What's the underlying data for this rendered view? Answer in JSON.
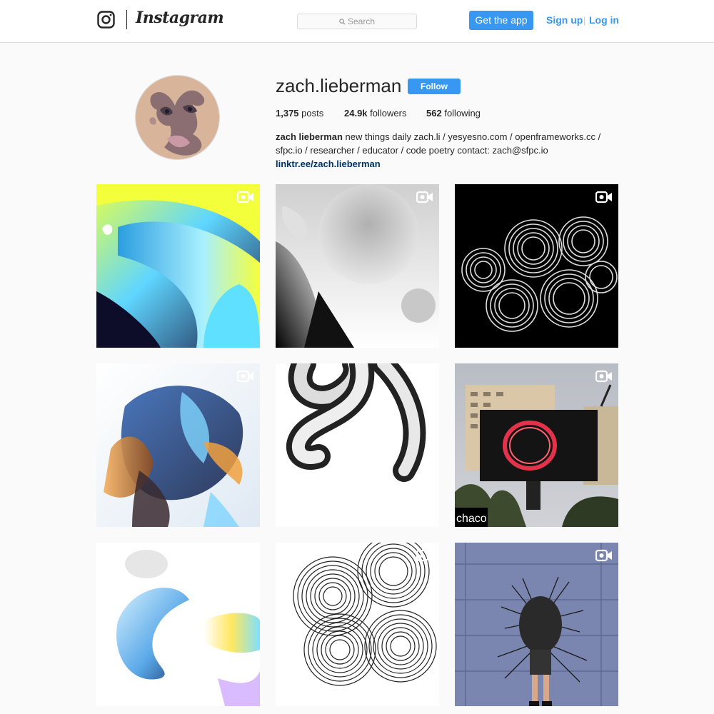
{
  "header": {
    "brand": "Instagram",
    "search_placeholder": "Search",
    "get_app_label": "Get the app",
    "signup_label": "Sign up",
    "separator": "|",
    "login_label": "Log in"
  },
  "profile": {
    "username": "zach.lieberman",
    "follow_label": "Follow",
    "posts_count": "1,375",
    "posts_label": "posts",
    "followers_count": "24.9k",
    "followers_label": "followers",
    "following_count": "562",
    "following_label": "following",
    "full_name": "zach lieberman",
    "bio_text": " new things daily zach.li / yesyesno.com / openframeworks.cc / sfpc.io / researcher / educator / code poetry contact: zach@sfpc.io ",
    "bio_link": "linktr.ee/zach.lieberman"
  },
  "posts": [
    {
      "icon": "video-icon"
    },
    {
      "icon": "video-icon"
    },
    {
      "icon": "video-icon"
    },
    {
      "icon": "video-icon"
    },
    {
      "icon": "video-icon"
    },
    {
      "icon": "video-icon",
      "overlay_text": "chaco"
    },
    {
      "icon": "video-icon"
    },
    {
      "icon": "video-icon"
    },
    {
      "icon": "video-icon"
    }
  ],
  "colors": {
    "accent": "#3897f0",
    "link": "#003569",
    "border": "#dbdbdb"
  }
}
